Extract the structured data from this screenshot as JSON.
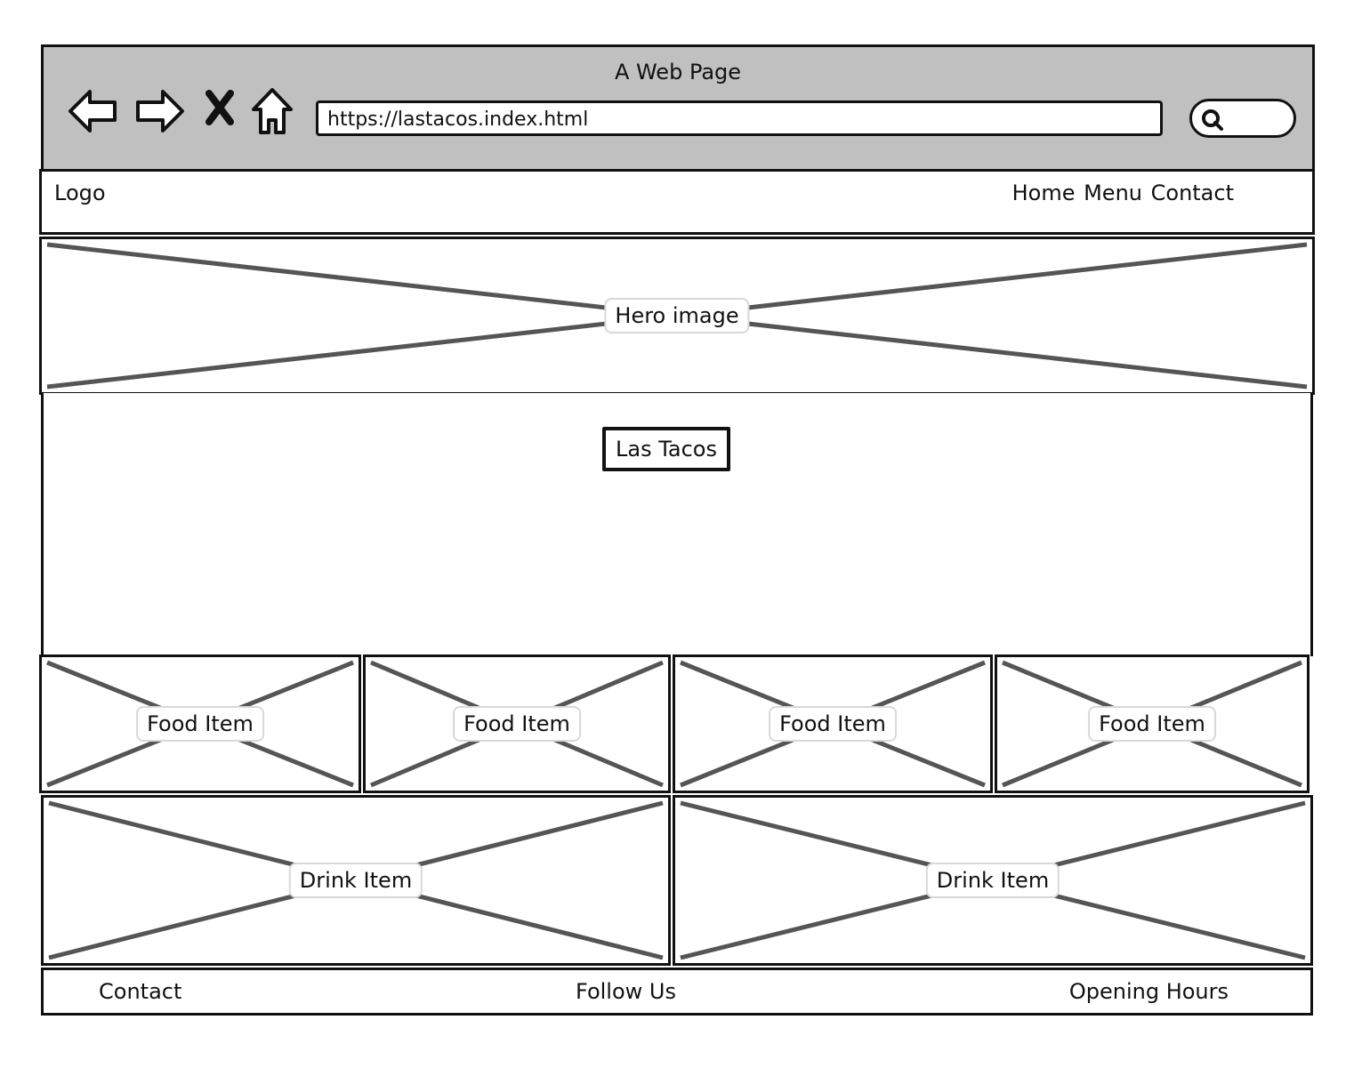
{
  "browser": {
    "title": "A Web Page",
    "url": "https://lastacos.index.html",
    "icons": [
      "back-arrow-icon",
      "forward-arrow-icon",
      "close-x-icon",
      "home-icon",
      "search-icon"
    ]
  },
  "header": {
    "logo": "Logo",
    "nav": "Home Menu Contact"
  },
  "hero": {
    "label": "Hero image"
  },
  "main": {
    "button_label": "Las Tacos"
  },
  "food_items": [
    {
      "label": "Food Item"
    },
    {
      "label": "Food Item"
    },
    {
      "label": "Food Item"
    },
    {
      "label": "Food Item"
    }
  ],
  "drink_items": [
    {
      "label": "Drink Item"
    },
    {
      "label": "Drink Item"
    }
  ],
  "footer": {
    "contact": "Contact",
    "follow": "Follow Us",
    "hours": "Opening Hours"
  },
  "colors": {
    "browser_bar": "#c0c0c0",
    "border": "#111111",
    "placeholder_cross": "#555555"
  }
}
